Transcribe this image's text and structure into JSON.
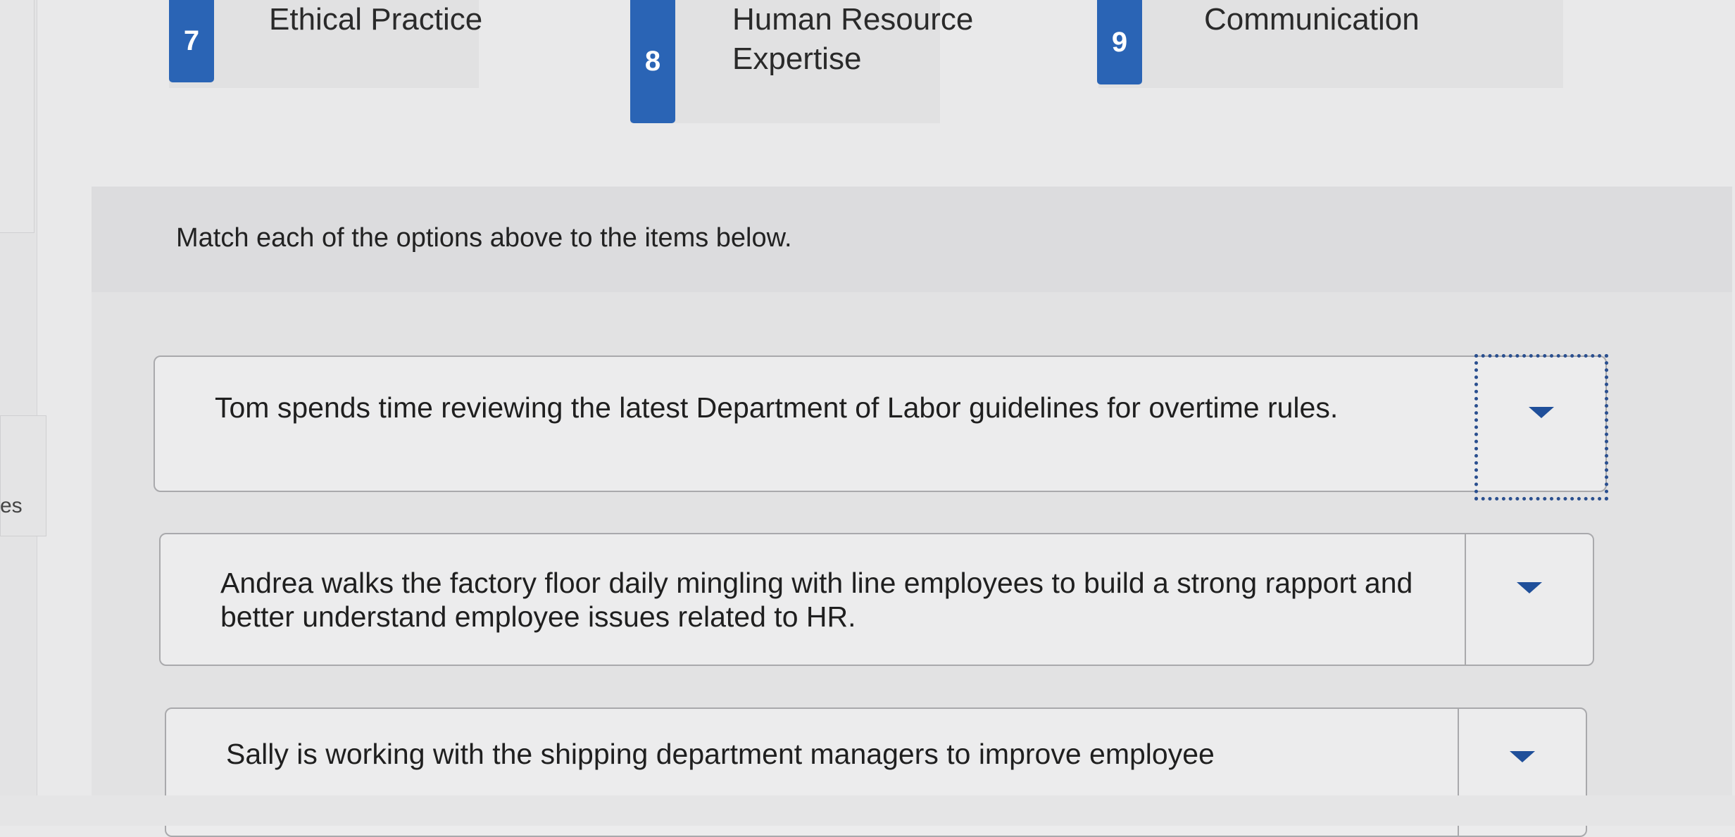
{
  "sidebar": {
    "partial_label": "es"
  },
  "options": [
    {
      "number": "7",
      "label": "Ethical Practice"
    },
    {
      "number": "8",
      "label": "Human Resource Expertise"
    },
    {
      "number": "9",
      "label": "Communication"
    }
  ],
  "instruction": "Match each of the options above to the items below.",
  "items": [
    {
      "text": "Tom spends time reviewing the latest Department of Labor guidelines for overtime rules.",
      "selected": ""
    },
    {
      "text": "Andrea walks the factory floor daily mingling with line employees to build a strong rapport and better understand employee issues related to HR.",
      "selected": ""
    },
    {
      "text": "Sally is working with the shipping department managers to improve employee",
      "selected": ""
    }
  ]
}
